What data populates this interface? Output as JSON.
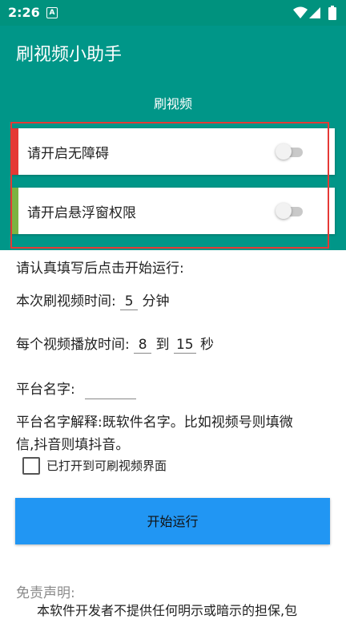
{
  "status_bar": {
    "time": "2:26",
    "notification_icon": "A",
    "icons": [
      "wifi-icon",
      "signal-icon",
      "battery-icon"
    ]
  },
  "app_bar": {
    "title": "刷视频小助手",
    "tab": "刷视频"
  },
  "permissions": [
    {
      "label": "请开启无障碍",
      "enabled": false
    },
    {
      "label": "请开启悬浮窗权限",
      "enabled": false
    }
  ],
  "form": {
    "intro": "请认真填写后点击开始运行:",
    "session_label": "本次刷视频时间:",
    "session_value": "5",
    "session_unit": "分钟",
    "play_label": "每个视频播放时间:",
    "play_min": "8",
    "play_to": "到",
    "play_max": "15",
    "play_unit": "秒",
    "platform_label": "平台名字:",
    "platform_value": "",
    "platform_help_line1": "平台名字解释:既软件名字。比如视频号则填微",
    "platform_help_line2": "信,抖音则填抖音。",
    "checkbox_label": "已打开到可刷视频界面",
    "checkbox_checked": false
  },
  "start_button": "开始运行",
  "disclaimer": {
    "title": "免责声明:",
    "body": "本软件开发者不提供任何明示或暗示的担保,包"
  },
  "colors": {
    "primary": "#009688",
    "status_bar": "#00927e",
    "button": "#2196f3",
    "highlight_frame": "#e53935",
    "accent_red": "#e53935",
    "accent_green": "#4caf50"
  }
}
